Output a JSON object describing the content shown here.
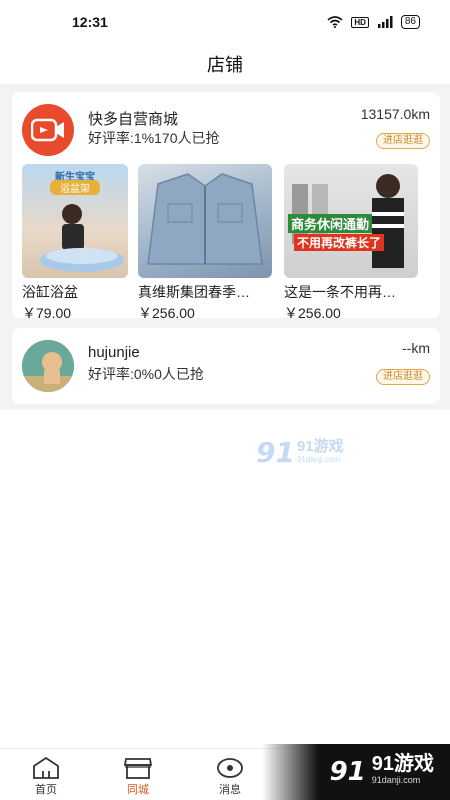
{
  "status": {
    "time": "12:31",
    "battery": "86",
    "hd": "HD"
  },
  "header": {
    "title": "店铺"
  },
  "shops": [
    {
      "name": "快多自营商城",
      "meta": "好评率:1%170人已抢",
      "distance": "13157.0km",
      "visit_label": "进店逛逛",
      "products": [
        {
          "name": "浴缸浴盆",
          "price": "￥79.00",
          "overlay_top": "新生宝宝",
          "overlay_sub": "浴盆架"
        },
        {
          "name": "真维斯集团春季…",
          "price": "￥256.00"
        },
        {
          "name": "这是一条不用再…",
          "price": "￥256.00",
          "overlay_line1": "商务休闲通勤",
          "overlay_line2": "不用再改裤长了"
        }
      ]
    },
    {
      "name": "hujunjie",
      "meta": "好评率:0%0人已抢",
      "distance": "--km",
      "visit_label": "进店逛逛"
    }
  ],
  "watermark": {
    "brand": "91游戏",
    "domain": "91danji.com"
  },
  "tabs": [
    {
      "label": "首页",
      "icon": "home-icon"
    },
    {
      "label": "同城",
      "icon": "store-icon",
      "active": true
    },
    {
      "label": "消息",
      "icon": "eye-icon"
    }
  ],
  "colors": {
    "accent": "#d4581f",
    "visit_border": "#e0a84a",
    "logo_red": "#e84a2b"
  }
}
